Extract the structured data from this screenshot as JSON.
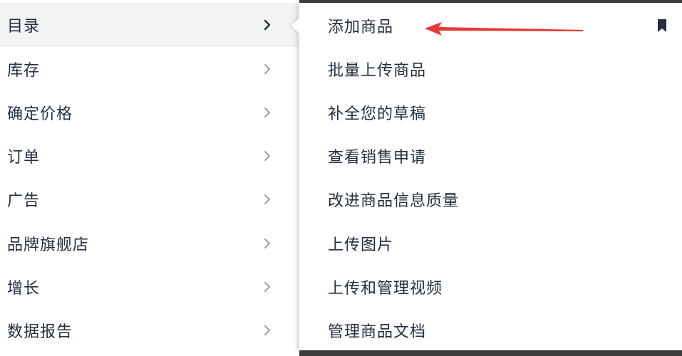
{
  "left_menu": {
    "items": [
      {
        "label": "目录",
        "active": true
      },
      {
        "label": "库存",
        "active": false
      },
      {
        "label": "确定价格",
        "active": false
      },
      {
        "label": "订单",
        "active": false
      },
      {
        "label": "广告",
        "active": false
      },
      {
        "label": "品牌旗舰店",
        "active": false
      },
      {
        "label": "增长",
        "active": false
      },
      {
        "label": "数据报告",
        "active": false
      }
    ]
  },
  "submenu": {
    "items": [
      {
        "label": "添加商品"
      },
      {
        "label": "批量上传商品"
      },
      {
        "label": "补全您的草稿"
      },
      {
        "label": "查看销售申请"
      },
      {
        "label": "改进商品信息质量"
      },
      {
        "label": "上传图片"
      },
      {
        "label": "上传和管理视频"
      },
      {
        "label": "管理商品文档"
      }
    ],
    "bookmark_icon": "bookmark-icon"
  },
  "colors": {
    "text": "#232f3e",
    "active_bg": "#f2f4f4",
    "chevron_active": "#232f3e",
    "chevron_inactive": "#9aa0a6",
    "annotation_arrow": "#e53935",
    "panel_border": "#3c3c3c"
  }
}
